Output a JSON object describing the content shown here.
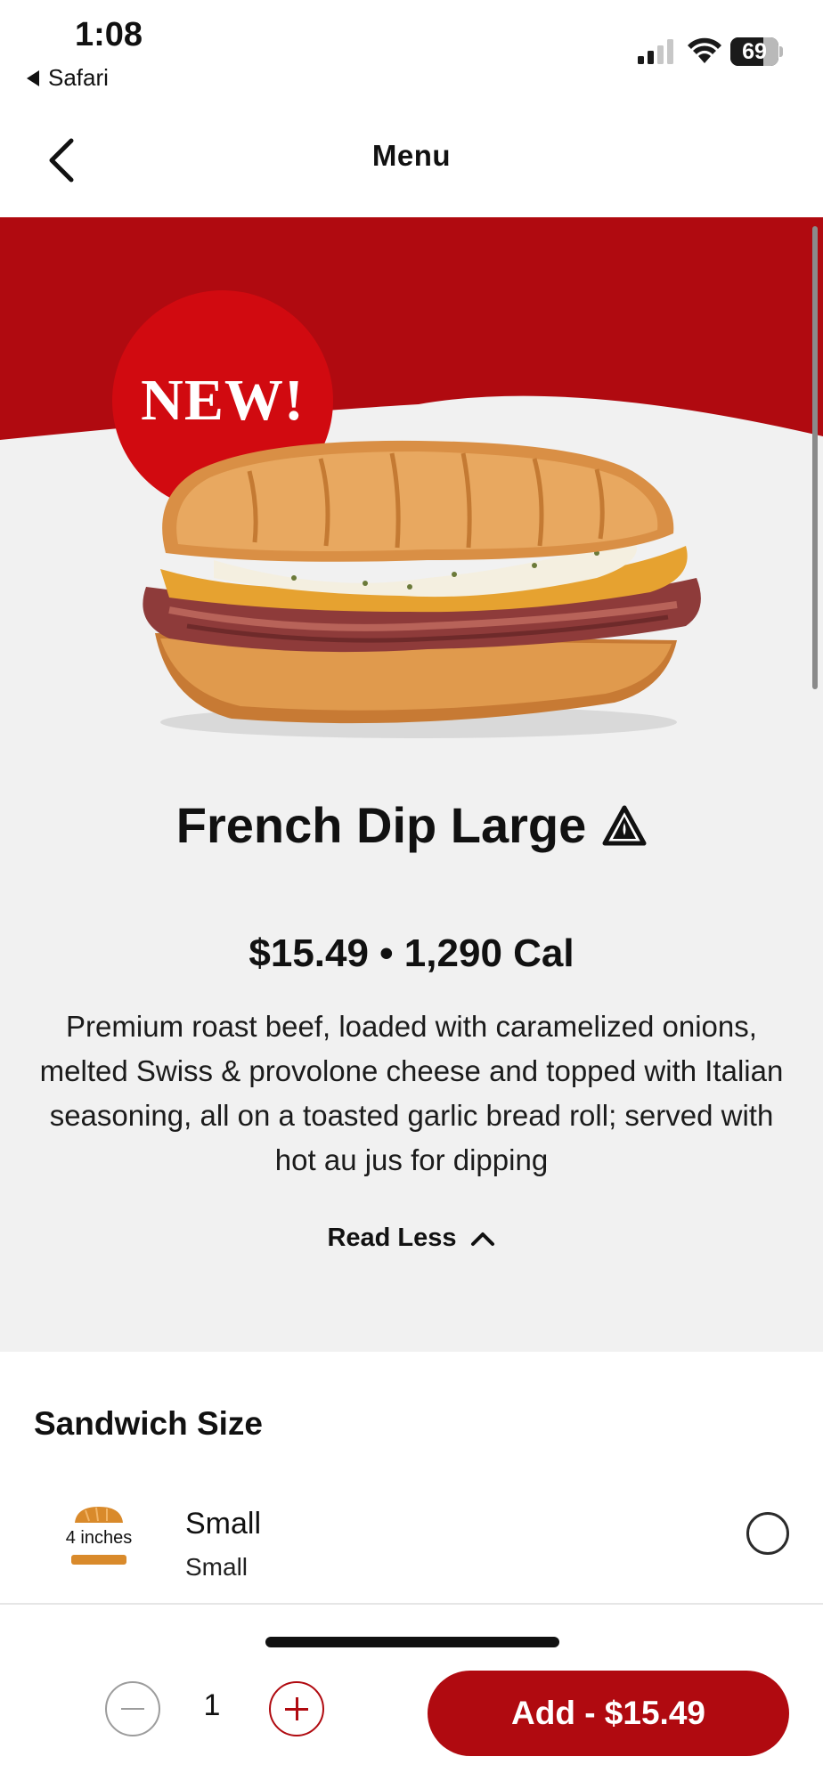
{
  "status_bar": {
    "time": "1:08",
    "back_app": "Safari",
    "battery": "69",
    "battery_level": 0.69
  },
  "nav": {
    "title": "Menu"
  },
  "hero": {
    "badge": "NEW!",
    "brand_red": "#b00a10"
  },
  "product": {
    "name": "French Dip Large",
    "price_line": "$15.49 • 1,290 Cal",
    "description": "Premium roast beef, loaded with caramelized onions, melted Swiss & provolone cheese and topped with Italian seasoning, all on a toasted garlic bread roll; served with hot au jus for dipping",
    "read_less": "Read Less"
  },
  "size_section": {
    "heading": "Sandwich Size",
    "options": [
      {
        "icon_caption": "4 inches",
        "label": "Small",
        "sublabel": "Small",
        "selected": false
      }
    ]
  },
  "action_bar": {
    "quantity": "1",
    "add_label": "Add - $15.49"
  }
}
